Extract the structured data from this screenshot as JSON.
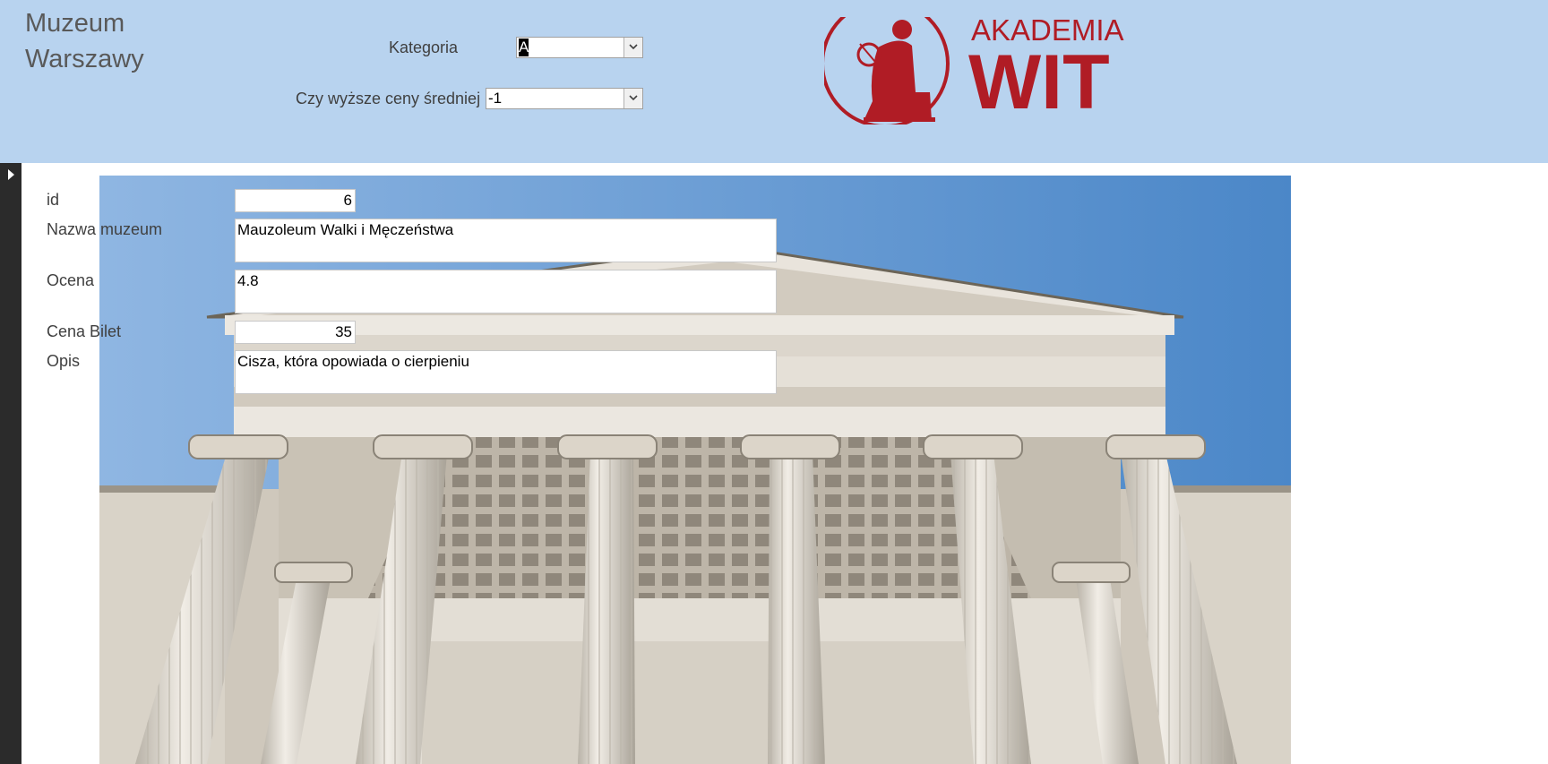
{
  "header": {
    "title_line1": "Muzeum",
    "title_line2": "Warszawy",
    "filters": {
      "kategoria_label": "Kategoria",
      "kategoria_value": "A",
      "wyzsze_label": "Czy wyższe ceny średniej",
      "wyzsze_value": "-1"
    },
    "logo": {
      "line1": "AKADEMIA",
      "line2": "WIT",
      "color": "#b01c25"
    }
  },
  "form": {
    "id_label": "id",
    "id_value": "6",
    "nazwa_label": "Nazwa muzeum",
    "nazwa_value": "Mauzoleum Walki i Męczeństwa",
    "ocena_label": "Ocena",
    "ocena_value": "4.8",
    "cena_label": "Cena Bilet",
    "cena_value": "35",
    "opis_label": "Opis",
    "opis_value": "Cisza, która opowiada o cierpieniu"
  },
  "colors": {
    "header_bg": "#b8d3ef",
    "sky": "#6ea2d8",
    "stone": "#d8d2c6"
  },
  "icons": {
    "selector": "record-selector-arrow-icon",
    "dropdown": "chevron-down-icon"
  }
}
